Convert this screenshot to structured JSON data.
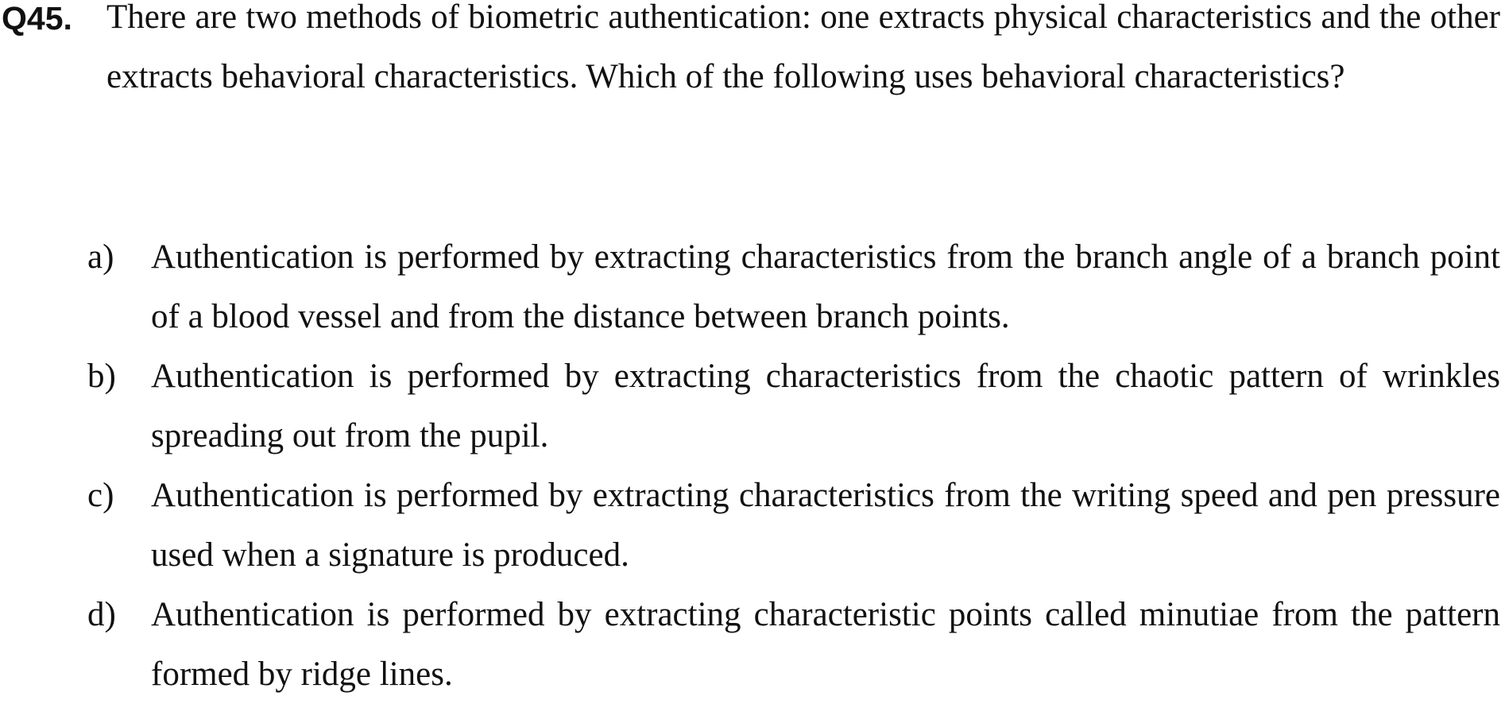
{
  "question": {
    "number": "Q45.",
    "text": "There are two methods of biometric authentication: one extracts physical characteristics and the other extracts behavioral characteristics.  Which of the following uses behavioral characteristics?"
  },
  "options": [
    {
      "label": "a)",
      "text": "Authentication is performed by extracting characteristics from the branch angle of a branch point of a blood vessel and from the distance between branch points."
    },
    {
      "label": "b)",
      "text": "Authentication is performed by extracting characteristics from the chaotic pattern of wrinkles spreading out from the pupil."
    },
    {
      "label": "c)",
      "text": "Authentication is performed by extracting characteristics from the writing speed and pen pressure used when a signature is produced."
    },
    {
      "label": "d)",
      "text": "Authentication is performed by extracting characteristic points called minutiae from the pattern formed by ridge lines."
    }
  ]
}
